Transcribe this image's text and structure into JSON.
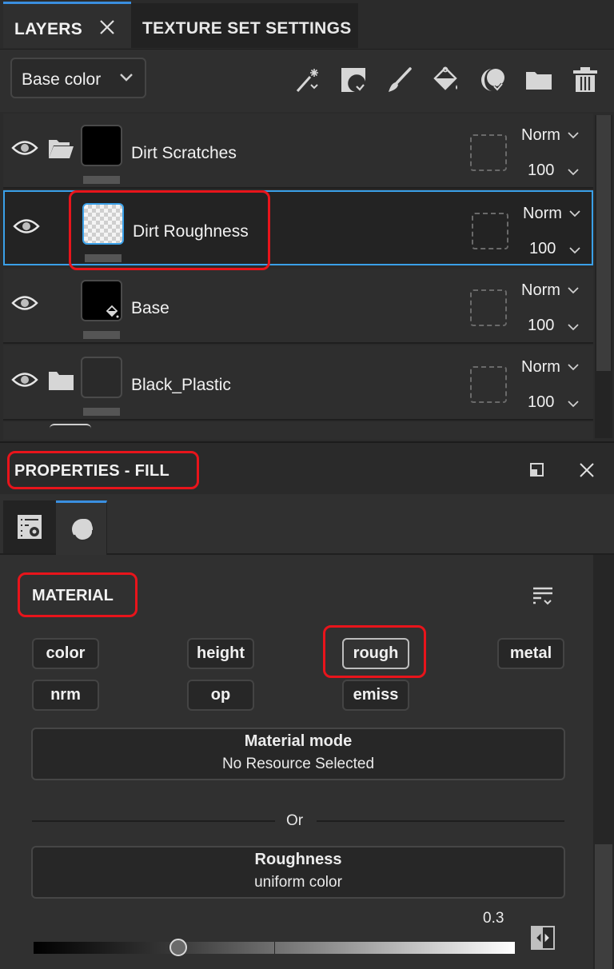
{
  "tabs": {
    "layers_label": "LAYERS",
    "texture_set_label": "TEXTURE SET SETTINGS"
  },
  "toolbar": {
    "channel_value": "Base color",
    "tools": [
      "add-effect",
      "add-mask",
      "add-paint-layer",
      "add-fill-layer",
      "add-smart-material",
      "add-folder",
      "delete"
    ]
  },
  "layers": [
    {
      "name": "Dirt Scratches",
      "type": "folder-open",
      "thumb": "black",
      "blend": "Norm",
      "opacity": "100",
      "selected": false
    },
    {
      "name": "Dirt Roughness",
      "type": "fill",
      "thumb": "checker",
      "blend": "Norm",
      "opacity": "100",
      "selected": true
    },
    {
      "name": "Base",
      "type": "fill",
      "thumb": "black-fill",
      "blend": "Norm",
      "opacity": "100",
      "selected": false
    },
    {
      "name": "Black_Plastic",
      "type": "folder",
      "thumb": "dark",
      "blend": "Norm",
      "opacity": "100",
      "selected": false
    }
  ],
  "properties": {
    "title": "PROPERTIES - FILL",
    "section_title": "MATERIAL",
    "channels": [
      {
        "label": "color",
        "active": false
      },
      {
        "label": "height",
        "active": false
      },
      {
        "label": "rough",
        "active": true
      },
      {
        "label": "metal",
        "active": false
      },
      {
        "label": "nrm",
        "active": false
      },
      {
        "label": "op",
        "active": false
      },
      {
        "label": "emiss",
        "active": false
      }
    ],
    "material_mode": {
      "title": "Material mode",
      "value": "No Resource Selected"
    },
    "or_label": "Or",
    "roughness": {
      "title": "Roughness",
      "value": "uniform color"
    },
    "slider": {
      "value_label": "0.3",
      "value": 0.3,
      "min": 0,
      "max": 1
    }
  },
  "colors": {
    "accent": "#3a8fe0",
    "highlight": "#e8141b",
    "selection_border": "#3aa0e8"
  }
}
